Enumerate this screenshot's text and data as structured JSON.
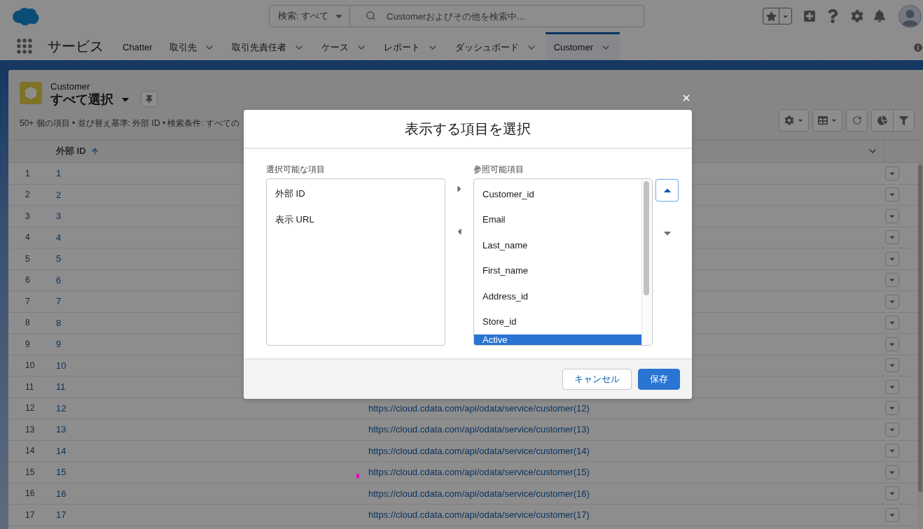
{
  "header": {
    "search_scope": "検索: すべて",
    "search": {
      "placeholder": "Customerおよびその他を検索中..."
    }
  },
  "nav": {
    "app_name": "サービス",
    "tabs": [
      {
        "label": "Chatter",
        "menu": false,
        "selected": false
      },
      {
        "label": "取引先",
        "menu": true,
        "selected": false
      },
      {
        "label": "取引先責任者",
        "menu": true,
        "selected": false
      },
      {
        "label": "ケース",
        "menu": true,
        "selected": false
      },
      {
        "label": "レポート",
        "menu": true,
        "selected": false
      },
      {
        "label": "ダッシュボード",
        "menu": true,
        "selected": false
      },
      {
        "label": "Customer",
        "menu": true,
        "selected": true
      }
    ]
  },
  "list_view": {
    "object": "Customer",
    "title": "すべて選択",
    "summary": "50+ 個の項目 • 並び替え基準: 外部 ID • 検索条件: すべての"
  },
  "table": {
    "columns": [
      {
        "label": "外部 ID",
        "sorted": true
      },
      {
        "menu": true
      }
    ],
    "rows": [
      {
        "number": "1",
        "id": "1"
      },
      {
        "number": "2",
        "id": "2"
      },
      {
        "number": "3",
        "id": "3"
      },
      {
        "number": "4",
        "id": "4"
      },
      {
        "number": "5",
        "id": "5"
      },
      {
        "number": "6",
        "id": "6"
      },
      {
        "number": "7",
        "id": "7"
      },
      {
        "number": "8",
        "id": "8"
      },
      {
        "number": "9",
        "id": "9"
      },
      {
        "number": "10",
        "id": "10"
      },
      {
        "number": "11",
        "id": "11"
      },
      {
        "number": "12",
        "id": "12",
        "url": "https://cloud.cdata.com/api/odata/service/customer(12)"
      },
      {
        "number": "13",
        "id": "13",
        "url": "https://cloud.cdata.com/api/odata/service/customer(13)"
      },
      {
        "number": "14",
        "id": "14",
        "url": "https://cloud.cdata.com/api/odata/service/customer(14)"
      },
      {
        "number": "15",
        "id": "15",
        "url": "https://cloud.cdata.com/api/odata/service/customer(15)"
      },
      {
        "number": "16",
        "id": "16",
        "url": "https://cloud.cdata.com/api/odata/service/customer(16)"
      },
      {
        "number": "17",
        "id": "17",
        "url": "https://cloud.cdata.com/api/odata/service/customer(17)"
      }
    ]
  },
  "dialog": {
    "title": "表示する項目を選択",
    "available": {
      "label": "選択可能な項目",
      "items": [
        {
          "label": "外部 ID",
          "selected": false
        },
        {
          "label": "表示 URL",
          "selected": false
        }
      ]
    },
    "visible": {
      "label": "参照可能項目",
      "items": [
        {
          "label": "Customer_id",
          "selected": false
        },
        {
          "label": "Email",
          "selected": false
        },
        {
          "label": "Last_name",
          "selected": false
        },
        {
          "label": "First_name",
          "selected": false
        },
        {
          "label": "Address_id",
          "selected": false
        },
        {
          "label": "Store_id",
          "selected": false
        },
        {
          "label": "Active",
          "selected": true
        }
      ]
    },
    "reorder_buttons": [
      {
        "kind": "up",
        "focused": true
      },
      {
        "kind": "down",
        "focused": false
      }
    ],
    "buttons": [
      {
        "label": "キャンセル",
        "kind": "neutral"
      },
      {
        "label": "保存",
        "kind": "brand"
      }
    ]
  }
}
